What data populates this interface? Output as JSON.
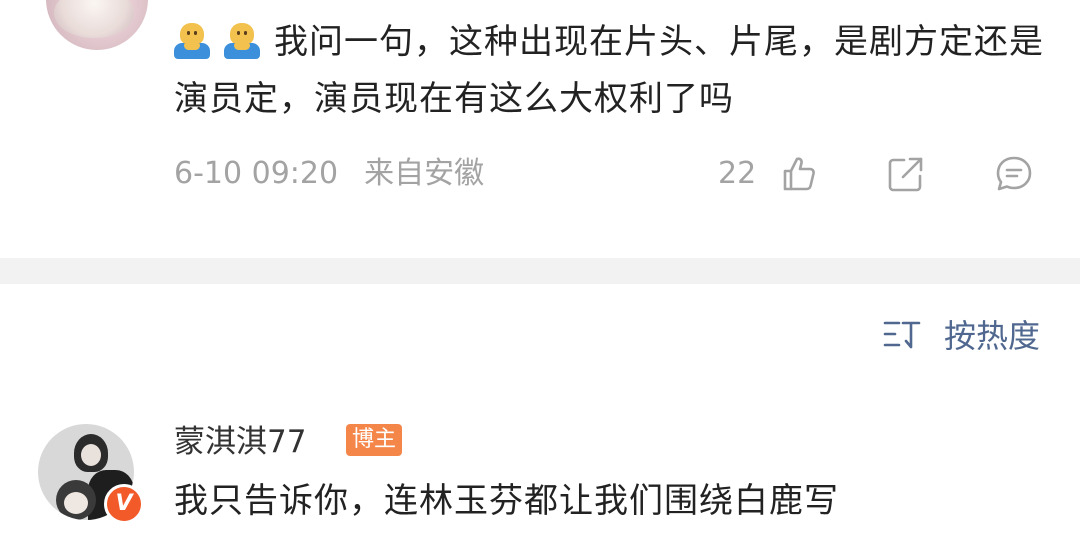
{
  "top_comment": {
    "emojis": [
      "emoji-doge-icon",
      "emoji-doge-icon"
    ],
    "text": "我问一句，这种出现在片头、片尾，是剧方定还是演员定，演员现在有这么大权利了吗",
    "timestamp": "6-10 09:20",
    "location": "来自安徽",
    "like_count": "22"
  },
  "sort_bar": {
    "label": "按热度"
  },
  "second_comment": {
    "username": "蒙淇淇77",
    "badge": "博主",
    "verified_mark": "V",
    "text": "我只告诉你，连林玉芬都让我们围绕白鹿写"
  },
  "colors": {
    "meta_gray": "#a3a3a3",
    "link_blue": "#50688f",
    "badge_orange": "#f5864a",
    "verified_red": "#f25a2a",
    "divider": "#f2f2f2"
  }
}
